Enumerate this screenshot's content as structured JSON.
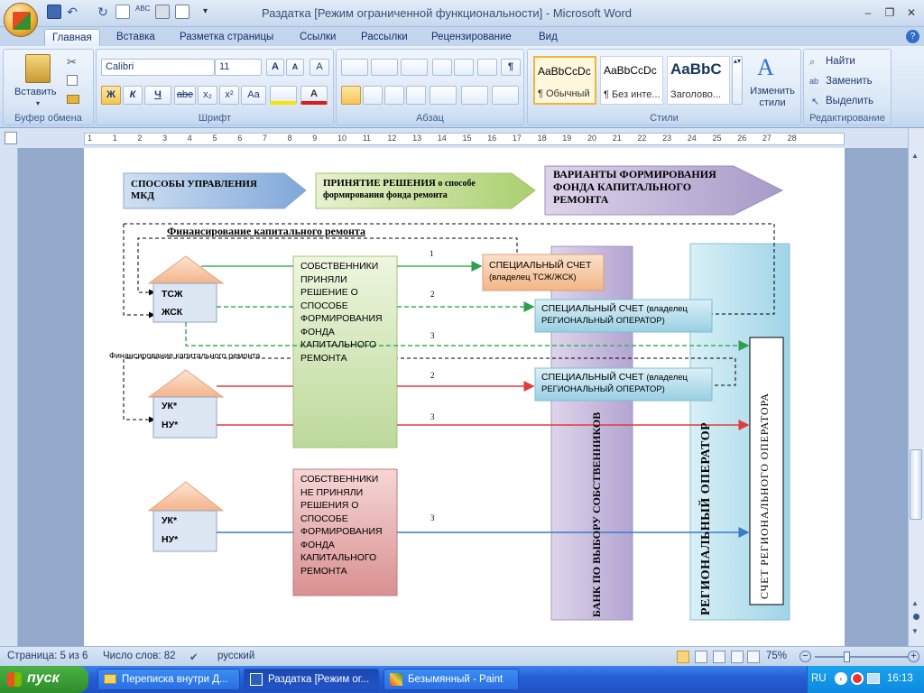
{
  "window": {
    "title": "Раздатка [Режим ограниченной функциональности] - Microsoft Word",
    "controls": [
      "–",
      "❐",
      "✕"
    ]
  },
  "tabs": [
    "Главная",
    "Вставка",
    "Разметка страницы",
    "Ссылки",
    "Рассылки",
    "Рецензирование",
    "Вид"
  ],
  "ribbon": {
    "clipboard": {
      "label": "Буфер обмена",
      "paste": "Вставить"
    },
    "font": {
      "label": "Шрифт",
      "name": "Calibri",
      "size": "11",
      "bold": "Ж",
      "italic": "К",
      "underline": "Ч",
      "strike": "abe",
      "sub": "x₂",
      "sup": "x²",
      "case": "Aa"
    },
    "paragraph": {
      "label": "Абзац"
    },
    "styles": {
      "label": "Стили",
      "items": [
        {
          "sample": "AaBbCcDc",
          "name": "¶ Обычный"
        },
        {
          "sample": "AaBbCcDc",
          "name": "¶ Без инте..."
        },
        {
          "sample": "AaBbC",
          "name": "Заголово..."
        }
      ],
      "change": "Изменить стили"
    },
    "editing": {
      "label": "Редактирование",
      "find": "Найти",
      "replace": "Заменить",
      "select": "Выделить"
    }
  },
  "ruler_numbers": [
    "1",
    "1",
    "2",
    "3",
    "4",
    "5",
    "6",
    "7",
    "8",
    "9",
    "10",
    "11",
    "12",
    "13",
    "14",
    "15",
    "16",
    "17",
    "18",
    "19",
    "20",
    "21",
    "22",
    "23",
    "24",
    "25",
    "26",
    "27",
    "28"
  ],
  "diagram": {
    "header1": "СПОСОБЫ УПРАВЛЕНИЯ МКД",
    "header2_bold": "ПРИНЯТИЕ РЕШЕНИЯ",
    "header2_rest": " о способе формирования фонда ремонта",
    "header3": "ВАРИАНТЫ ФОРМИРОВАНИЯ ФОНДА КАПИТАЛЬНОГО РЕМОНТА",
    "financing_title": "Финансирование  капитального ремонта",
    "financing_small": "Финансирование  капитального ремонта",
    "house1": [
      "ТСЖ",
      "ЖСК"
    ],
    "house2": [
      "УК*",
      "НУ*"
    ],
    "house3": [
      "УК*",
      "НУ*"
    ],
    "decided": "СОБСТВЕННИКИ ПРИНЯЛИ РЕШЕНИЕ О СПОСОБЕ ФОРМИРОВАНИЯ ФОНДА КАПИТАЛЬНОГО РЕМОНТА",
    "not_decided": "СОБСТВЕННИКИ НЕ ПРИНЯЛИ РЕШЕНИЯ О СПОСОБЕ ФОРМИРОВАНИЯ ФОНДА КАПИТАЛЬНОГО РЕМОНТА",
    "special_tsj": "СПЕЦИАЛЬНЫЙ СЧЕТ",
    "special_tsj_sub": "(владелец ТСЖ/ЖСК)",
    "special_ro": "СПЕЦИАЛЬНЫЙ СЧЕТ",
    "special_ro_sub": "(владелец РЕГИОНАЛЬНЫЙ ОПЕРАТОР)",
    "bank": "БАНК ПО ВЫБОРУ СОБСТВЕННИКОВ",
    "regional": "РЕГИОНАЛЬНЫЙ ОПЕРАТОР",
    "ro_account": "СЧЕТ РЕГИОНАЛЬНОГО ОПЕРАТОРА",
    "arrow_labels": [
      "1",
      "2",
      "3",
      "2",
      "3",
      "3"
    ]
  },
  "statusbar": {
    "page": "Страница: 5 из 6",
    "words": "Число слов: 82",
    "lang": "русский",
    "zoom": "75%"
  },
  "taskbar": {
    "start": "пуск",
    "tasks": [
      "Переписка внутри Д...",
      "Раздатка [Режим ог...",
      "Безымянный - Paint"
    ],
    "lang": "RU",
    "clock": "16:13"
  },
  "colors": {
    "green": "#3cae5a",
    "red": "#e23b3b",
    "blue": "#3a7cc9",
    "orange_box": "#f6c49a",
    "bank_col": "#c8bcdb",
    "regional_col": "#b9e1ee"
  }
}
